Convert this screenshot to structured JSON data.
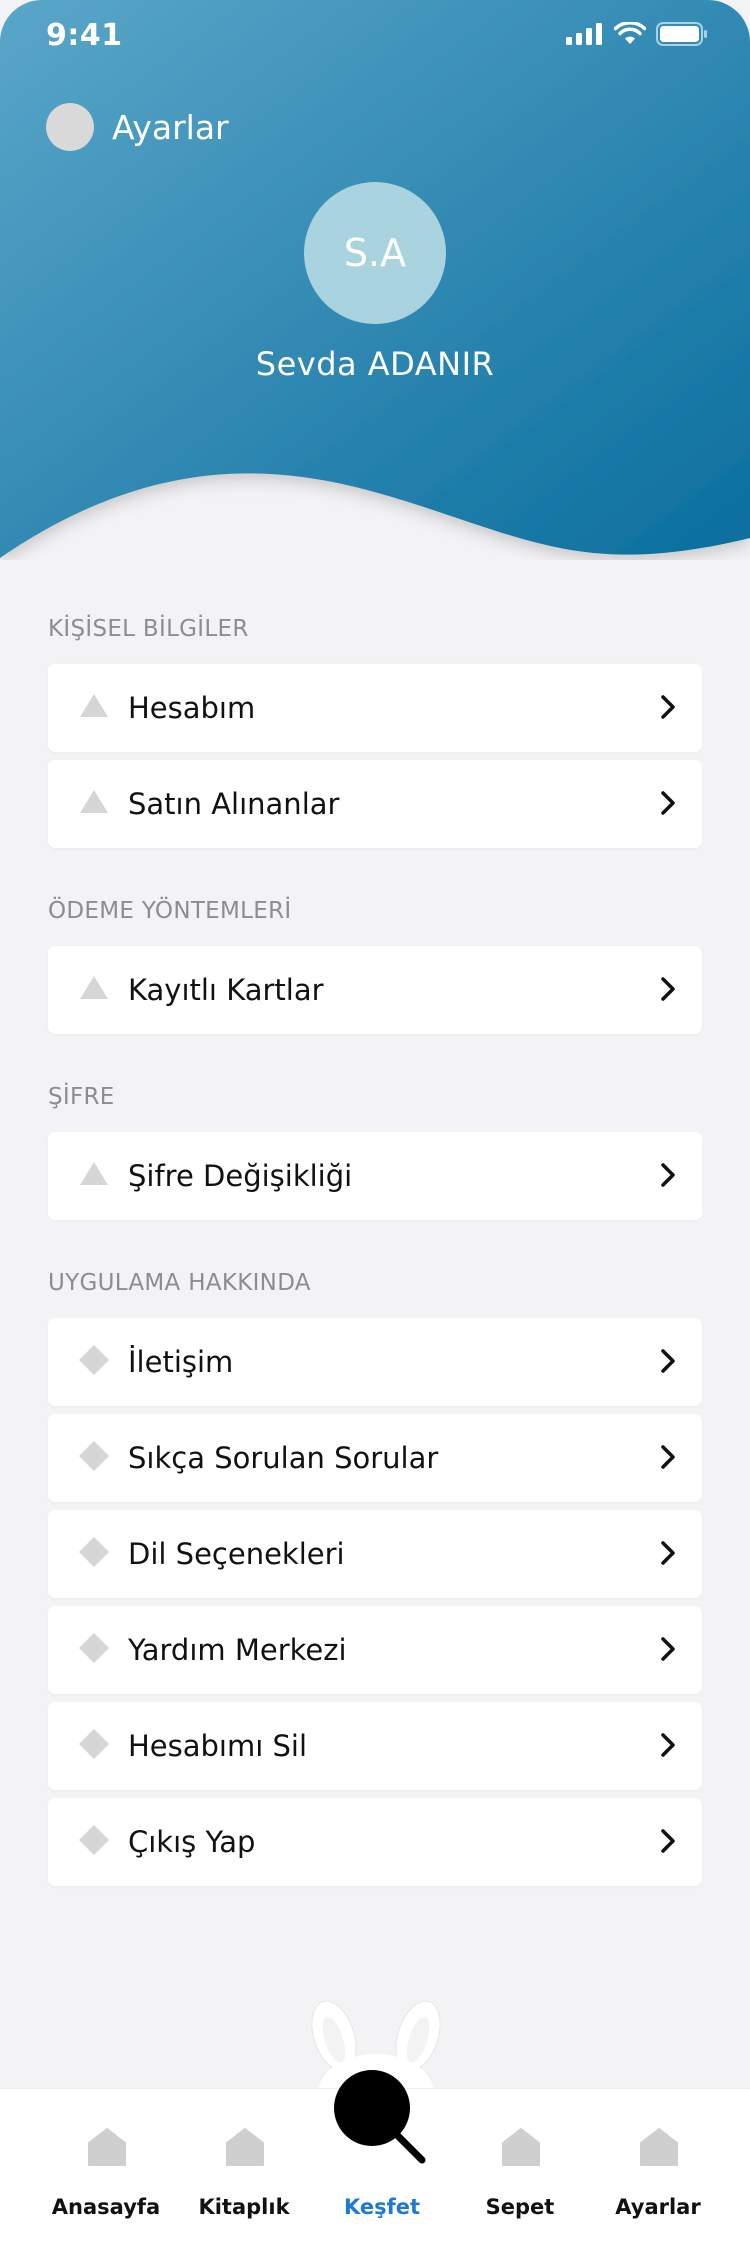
{
  "status_bar": {
    "time": "9:41"
  },
  "header": {
    "title": "Ayarlar",
    "avatar_initials": "S.A",
    "user_name": "Sevda ADANIR",
    "gradient_start": "#5aa6c9",
    "gradient_end": "#0a6e9e"
  },
  "sections": {
    "personal": {
      "title": "KİŞİSEL BİLGİLER",
      "items": [
        {
          "label": "Hesabım",
          "icon": "triangle-icon"
        },
        {
          "label": "Satın Alınanlar",
          "icon": "triangle-icon"
        }
      ]
    },
    "payment": {
      "title": "ÖDEME YÖNTEMLERİ",
      "items": [
        {
          "label": "Kayıtlı Kartlar",
          "icon": "triangle-icon"
        }
      ]
    },
    "password": {
      "title": "ŞİFRE",
      "items": [
        {
          "label": "Şifre Değişikliği",
          "icon": "triangle-icon"
        }
      ]
    },
    "about": {
      "title": "UYGULAMA HAKKINDA",
      "items": [
        {
          "label": "İletişim",
          "icon": "diamond-icon"
        },
        {
          "label": "Sıkça Sorulan Sorular",
          "icon": "diamond-icon"
        },
        {
          "label": "Dil Seçenekleri",
          "icon": "diamond-icon"
        },
        {
          "label": "Yardım Merkezi",
          "icon": "diamond-icon"
        },
        {
          "label": "Hesabımı Sil",
          "icon": "diamond-icon"
        },
        {
          "label": "Çıkış Yap",
          "icon": "diamond-icon"
        }
      ]
    }
  },
  "tabbar": {
    "tabs": [
      {
        "label": "Anasayfa",
        "icon": "home-icon"
      },
      {
        "label": "Kitaplık",
        "icon": "home-icon"
      },
      {
        "label": "Keşfet",
        "icon": "search-icon",
        "active": true
      },
      {
        "label": "Sepet",
        "icon": "home-icon"
      },
      {
        "label": "Ayarlar",
        "icon": "home-icon"
      }
    ],
    "active_color": "#1d78d6"
  }
}
